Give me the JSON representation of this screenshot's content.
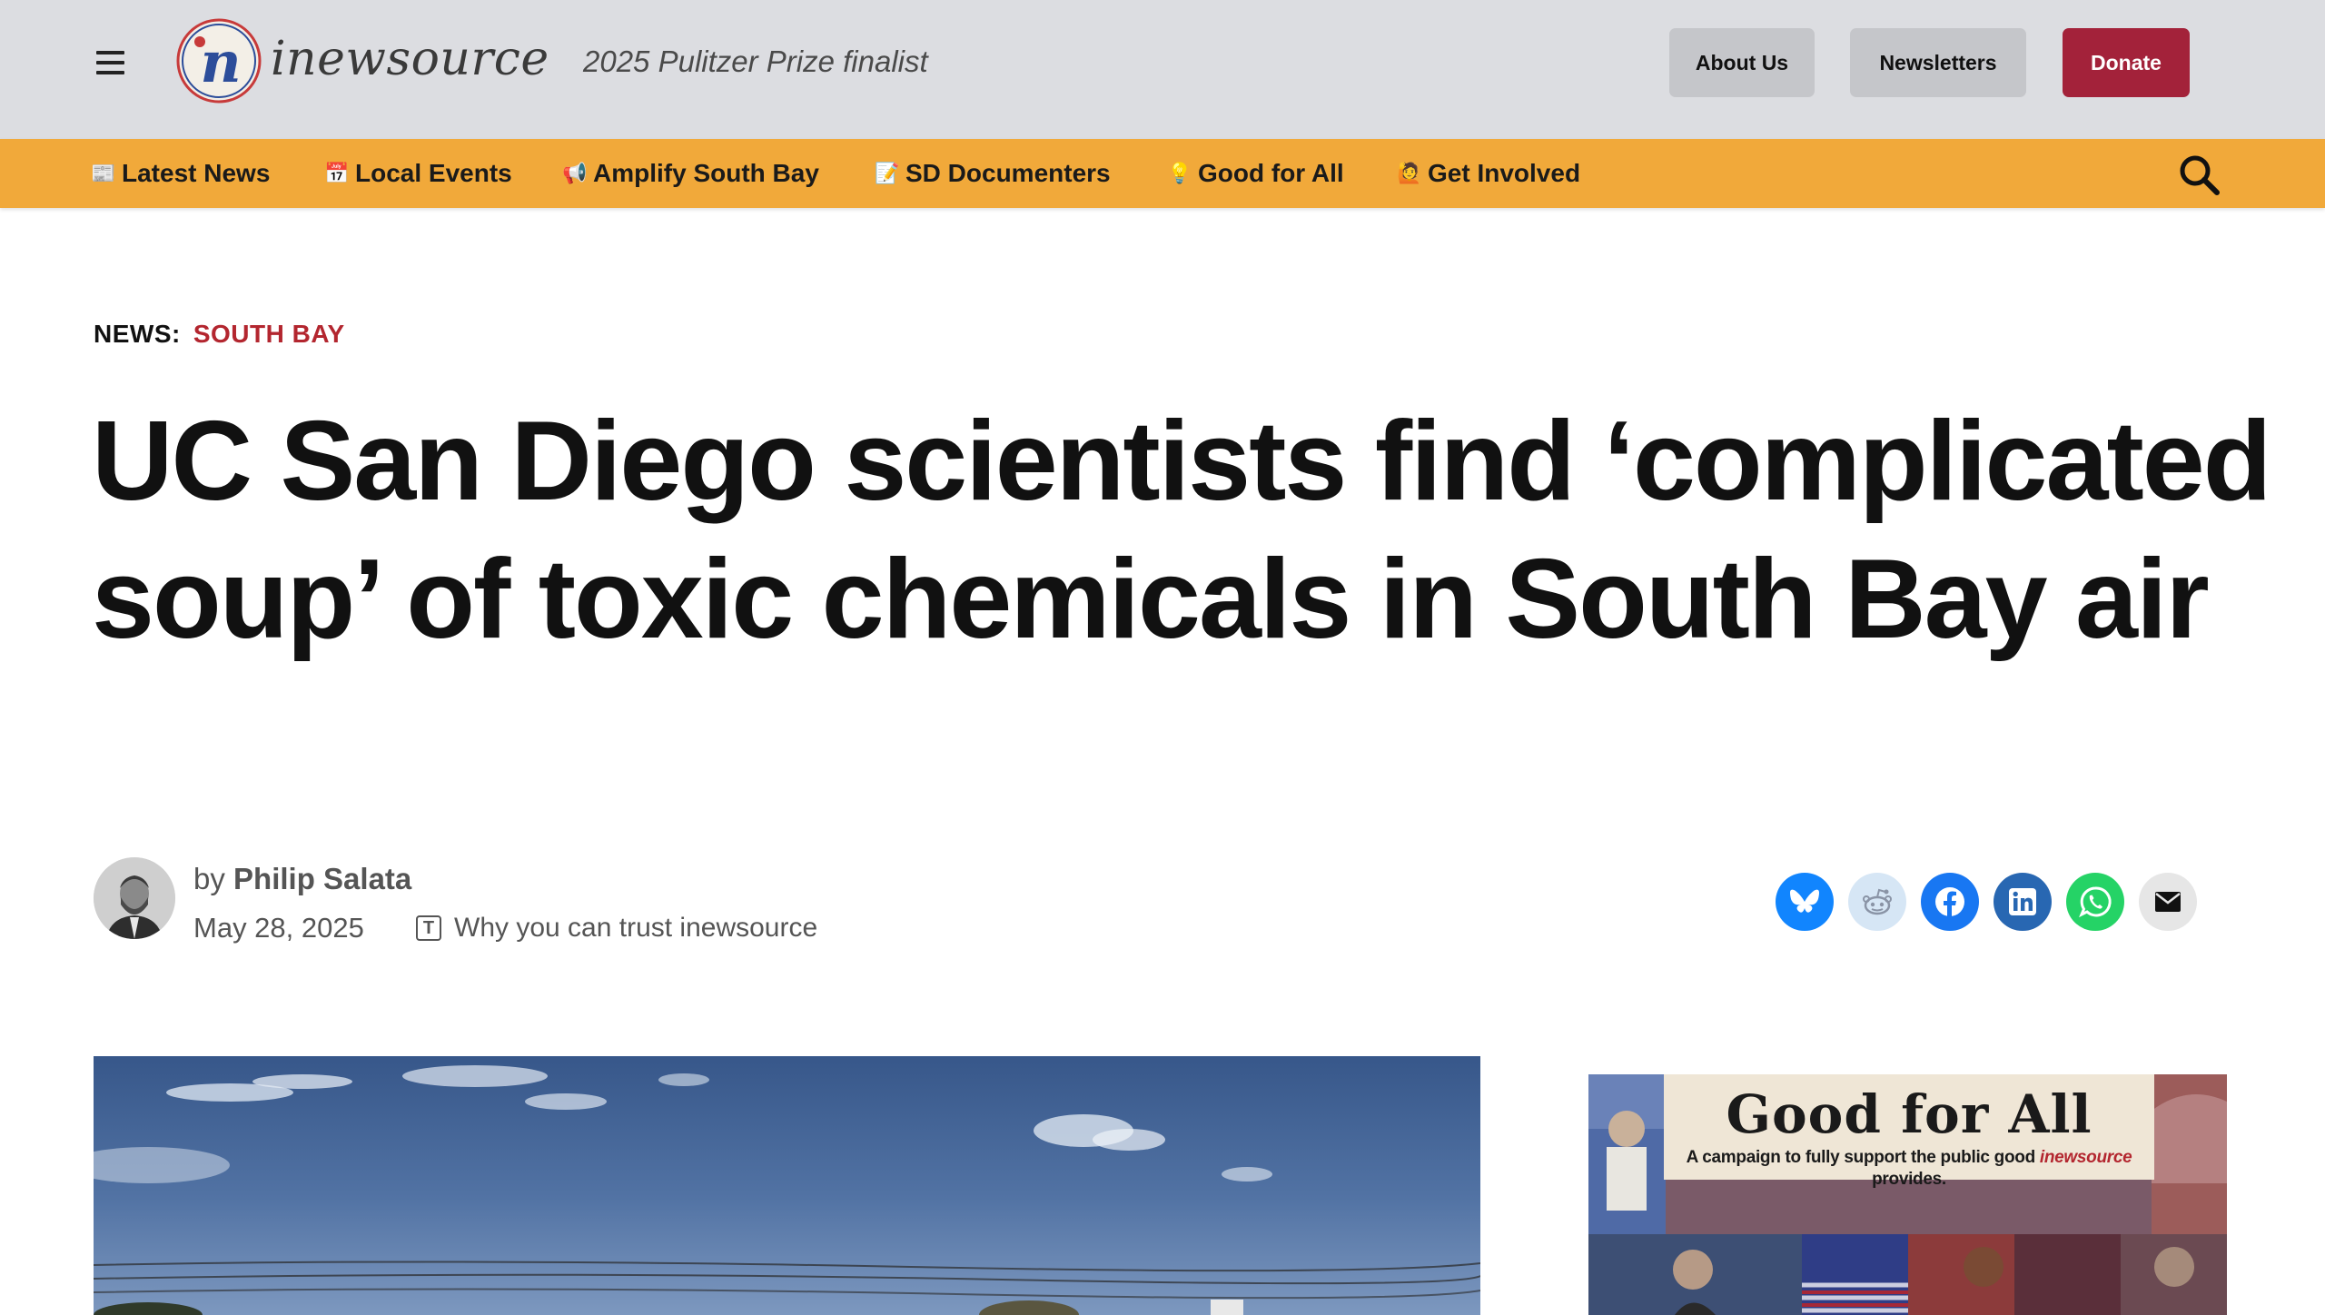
{
  "header": {
    "logo_text": "inewsource",
    "logo_letter": "n",
    "tagline": "2025 Pulitzer Prize finalist",
    "buttons": {
      "about": "About Us",
      "newsletters": "Newsletters",
      "donate": "Donate"
    }
  },
  "nav": {
    "items": [
      {
        "icon": "📰",
        "label": "Latest News"
      },
      {
        "icon": "📅",
        "label": "Local Events"
      },
      {
        "icon": "📢",
        "label": "Amplify South Bay"
      },
      {
        "icon": "📝",
        "label": "SD Documenters"
      },
      {
        "icon": "💡",
        "label": "Good for All"
      },
      {
        "icon": "🙋",
        "label": "Get Involved"
      }
    ],
    "search_icon": "search-icon"
  },
  "article": {
    "kicker_label": "NEWS:",
    "kicker_category": "SOUTH BAY",
    "headline": "UC San Diego scientists find ‘complicated soup’ of toxic chemicals in South Bay air",
    "byline_prefix": "by",
    "author": "Philip Salata",
    "date": "May 28, 2025",
    "trust_link": "Why you can trust inewsource"
  },
  "share": {
    "icons": [
      "bluesky-icon",
      "reddit-icon",
      "facebook-icon",
      "linkedin-icon",
      "whatsapp-icon",
      "email-icon"
    ],
    "colors": {
      "bluesky": "#1185fe",
      "reddit": "#d6e6f5",
      "facebook": "#1877f2",
      "linkedin": "#2867b2",
      "whatsapp": "#25d366",
      "email": "#e6e6e6"
    }
  },
  "promo": {
    "title": "Good for All",
    "subtitle_pre": "A campaign to fully support the public good ",
    "subtitle_brand": "inewsource",
    "subtitle_post": " provides."
  },
  "colors": {
    "topbar_bg": "#dcdde1",
    "nav_bg": "#f1a93a",
    "donate_bg": "#a3223a",
    "accent_red": "#b3262f"
  }
}
